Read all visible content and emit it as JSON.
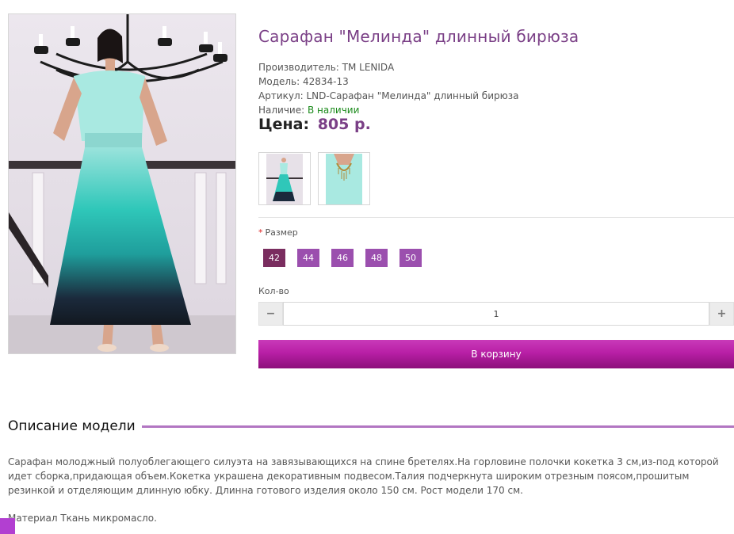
{
  "product": {
    "title": "Сарафан \"Мелинда\" длинный бирюза",
    "manufacturer": "Производитель: TM LENIDA",
    "model": "Модель: 42834-13",
    "article": "Артикул: LND-Сарафан \"Мелинда\" длинный бирюза",
    "availability_label": "Наличие: ",
    "availability_value": "В наличии",
    "price_label": "Цена:",
    "price_value": "805 р."
  },
  "options": {
    "size_label": "Размер",
    "required_mark": "*",
    "sizes": [
      "42",
      "44",
      "46",
      "48",
      "50"
    ],
    "selected_size": "42",
    "qty_label": "Кол-во",
    "qty_value": "1",
    "minus_symbol": "−",
    "plus_symbol": "+"
  },
  "cart": {
    "button_label": "В корзину"
  },
  "description": {
    "heading": "Описание модели",
    "text": "Сарафан молоджный полуоблегающего силуэта на завязывающихся на спине бретелях.На горловине полочки кокетка 3 см,из-под которой идет сборка,придающая объем.Кокетка украшена декоративным подвесом.Талия подчеркнута широким отрезным поясом,прошитым резинкой и отделяющим длинную юбку. Длинна готового изделия около 150 см. Рост модели 170 см.",
    "material": "Материал Ткань микромасло."
  },
  "colors": {
    "accent": "#7a3f86",
    "button": "#b81fa6",
    "size_bg": "#9b4fae",
    "size_active": "#7a2d5f",
    "availability": "#1a8a1a"
  },
  "icons": {
    "minus": "minus-icon",
    "plus": "plus-icon"
  }
}
